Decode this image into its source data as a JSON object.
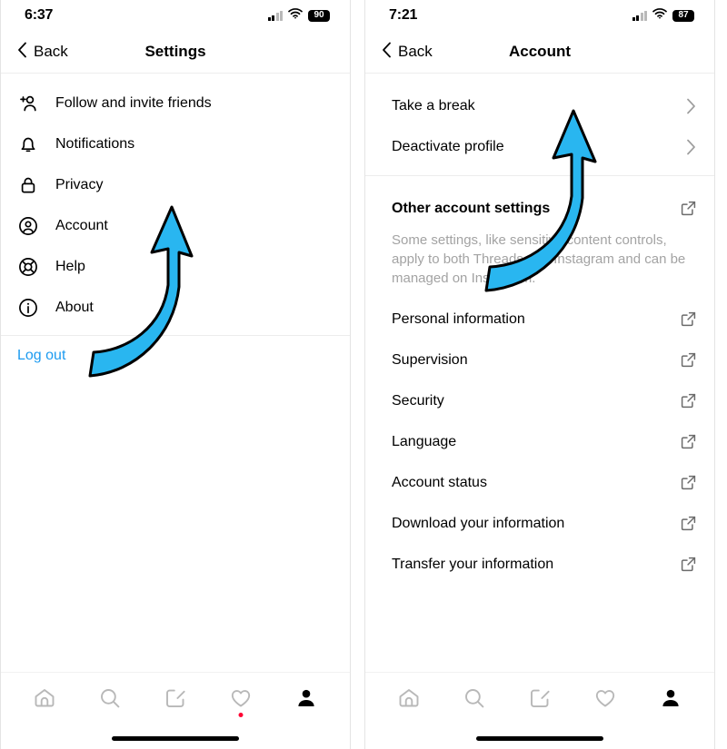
{
  "screens": [
    {
      "id": "settings-screen",
      "status": {
        "time": "6:37",
        "battery": "90",
        "signal_icon": "cellular-signal-icon",
        "wifi_icon": "wifi-icon",
        "battery_icon": "battery-icon"
      },
      "nav": {
        "back_label": "Back",
        "back_icon": "chevron-left-icon",
        "title": "Settings"
      },
      "items": [
        {
          "label": "Follow and invite friends",
          "icon": "person-add-icon"
        },
        {
          "label": "Notifications",
          "icon": "bell-icon"
        },
        {
          "label": "Privacy",
          "icon": "lock-icon"
        },
        {
          "label": "Account",
          "icon": "account-circle-icon"
        },
        {
          "label": "Help",
          "icon": "life-ring-icon"
        },
        {
          "label": "About",
          "icon": "info-circle-icon"
        }
      ],
      "logout_label": "Log out",
      "logout_color": "#1d9bf0",
      "annotation": {
        "type": "curved-arrow",
        "color": "#29b6f0",
        "outline": "#000000",
        "points_to": "Account"
      }
    },
    {
      "id": "account-screen",
      "status": {
        "time": "7:21",
        "battery": "87",
        "signal_icon": "cellular-signal-icon",
        "wifi_icon": "wifi-icon",
        "battery_icon": "battery-icon"
      },
      "nav": {
        "back_label": "Back",
        "back_icon": "chevron-left-icon",
        "title": "Account"
      },
      "group_one": [
        {
          "label": "Take a break",
          "accessory": "chevron-right-icon"
        },
        {
          "label": "Deactivate profile",
          "accessory": "chevron-right-icon"
        }
      ],
      "section": {
        "title": "Other account settings",
        "title_accessory": "external-link-icon",
        "description": "Some settings, like sensitive content controls, apply to both Threads and Instagram and can be managed on Instagram."
      },
      "group_two": [
        {
          "label": "Personal information",
          "accessory": "external-link-icon"
        },
        {
          "label": "Supervision",
          "accessory": "external-link-icon"
        },
        {
          "label": "Security",
          "accessory": "external-link-icon"
        },
        {
          "label": "Language",
          "accessory": "external-link-icon"
        },
        {
          "label": "Account status",
          "accessory": "external-link-icon"
        },
        {
          "label": "Download your information",
          "accessory": "external-link-icon"
        },
        {
          "label": "Transfer your information",
          "accessory": "external-link-icon"
        }
      ],
      "annotation": {
        "type": "curved-arrow",
        "color": "#29b6f0",
        "outline": "#000000",
        "points_to": "Deactivate profile"
      }
    }
  ],
  "tabbar": {
    "tabs": [
      {
        "name": "home-icon",
        "label": "Home"
      },
      {
        "name": "search-icon",
        "label": "Search"
      },
      {
        "name": "compose-icon",
        "label": "Compose"
      },
      {
        "name": "activity-heart-icon",
        "label": "Activity"
      },
      {
        "name": "profile-icon",
        "label": "Profile"
      }
    ],
    "activity_badge_color": "#ff0033",
    "home-indicator": "home-indicator"
  }
}
